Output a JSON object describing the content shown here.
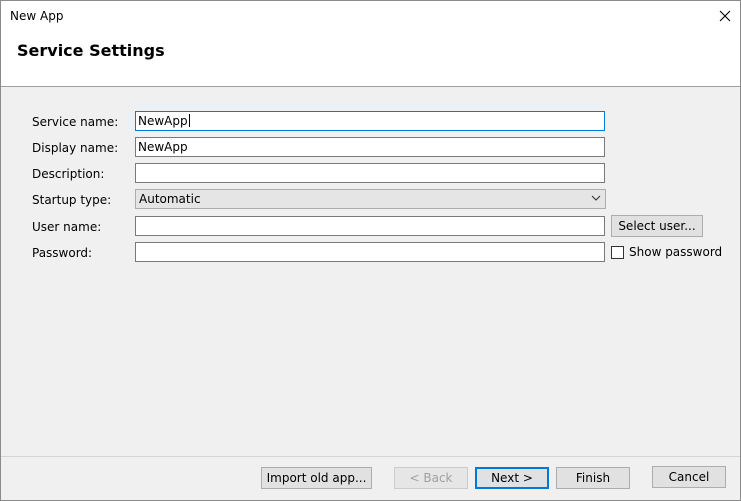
{
  "window": {
    "title": "New App",
    "close_icon": "close-icon"
  },
  "header": {
    "title": "Service Settings"
  },
  "form": {
    "service_name_label": "Service name:",
    "service_name_value": "NewApp",
    "display_name_label": "Display name:",
    "display_name_value": "NewApp",
    "description_label": "Description:",
    "description_value": "",
    "startup_type_label": "Startup type:",
    "startup_type_value": "Automatic",
    "user_name_label": "User name:",
    "user_name_value": "",
    "select_user_label": "Select user...",
    "password_label": "Password:",
    "password_value": "",
    "show_password_label": "Show password",
    "show_password_checked": false
  },
  "footer": {
    "import_label": "Import old app...",
    "back_label": "< Back",
    "next_label": "Next >",
    "finish_label": "Finish",
    "cancel_label": "Cancel"
  },
  "colors": {
    "accent": "#0078d7",
    "dialog_bg": "#f0f0f0",
    "header_bg": "#ffffff"
  }
}
